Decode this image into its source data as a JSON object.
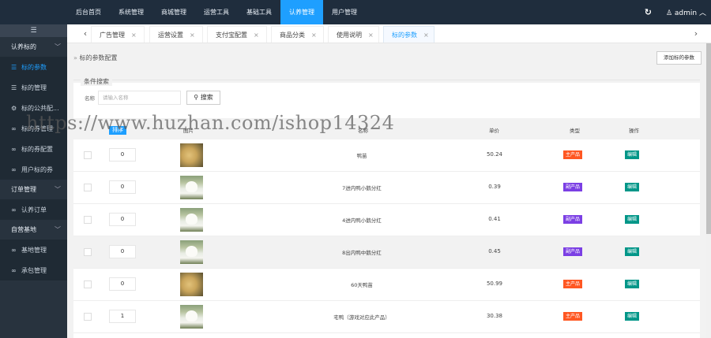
{
  "topnav": {
    "items": [
      "后台首页",
      "系统管理",
      "商城管理",
      "运营工具",
      "基础工具",
      "认养管理",
      "用户管理"
    ],
    "active_index": 5,
    "refresh_icon": "refresh-icon",
    "user_label": "admin",
    "user_icon": "user-icon"
  },
  "sidebar": {
    "toggle_icon": "menu-icon",
    "group1": {
      "label": "认养标的",
      "expanded": true
    },
    "items1": [
      {
        "label": "标的参数",
        "icon": "list-icon",
        "active": true
      },
      {
        "label": "标的管理",
        "icon": "list-icon"
      },
      {
        "label": "标的公共配...",
        "icon": "gear-icon"
      },
      {
        "label": "标的券管理",
        "icon": "link-icon"
      },
      {
        "label": "标的券配置",
        "icon": "link-icon"
      },
      {
        "label": "用户标的券",
        "icon": "link-icon"
      }
    ],
    "group2": {
      "label": "订单管理"
    },
    "items2": [
      {
        "label": "认养订单",
        "icon": "link-icon"
      }
    ],
    "group3": {
      "label": "自营基地"
    },
    "items3": [
      {
        "label": "基地管理",
        "icon": "link-icon"
      },
      {
        "label": "承包管理",
        "icon": "link-icon"
      }
    ]
  },
  "tabs": {
    "items": [
      "广告管理",
      "运营设置",
      "支付宝配置",
      "商品分类",
      "使用说明",
      "标的参数"
    ],
    "active_index": 5,
    "close_glyph": "×",
    "prev_glyph": "‹",
    "next_glyph": "›"
  },
  "page": {
    "breadcrumb_arrow": "»",
    "breadcrumb": "标的参数配置",
    "add_button": "添加标的参数"
  },
  "filter": {
    "title": "条件搜索",
    "label": "名称",
    "placeholder": "请输入名称",
    "search_button": "搜索"
  },
  "table": {
    "headers": {
      "sort": "排序",
      "image": "图片",
      "name": "名称",
      "price": "单价",
      "type": "类型",
      "action": "操作"
    },
    "rows": [
      {
        "sort": "0",
        "image": "chick",
        "name": "鸭苗",
        "price": "50.24",
        "type": "主产品",
        "type_kind": "main",
        "action": "编辑"
      },
      {
        "sort": "0",
        "image": "goose",
        "name": "7进内鸭小鹅分红",
        "price": "0.39",
        "type": "副产品",
        "type_kind": "dividend",
        "action": "编辑"
      },
      {
        "sort": "0",
        "image": "goose",
        "name": "4进内鸭小鹅分红",
        "price": "0.41",
        "type": "副产品",
        "type_kind": "dividend",
        "action": "编辑"
      },
      {
        "sort": "0",
        "image": "goose",
        "name": "8出内鸭中鹅分红",
        "price": "0.45",
        "type": "副产品",
        "type_kind": "dividend",
        "action": "编辑",
        "highlight": true
      },
      {
        "sort": "0",
        "image": "chick",
        "name": "60天鸭苗",
        "price": "50.99",
        "type": "主产品",
        "type_kind": "main",
        "action": "编辑"
      },
      {
        "sort": "1",
        "image": "goose",
        "name": "宅鸭（游戏对应此产品）",
        "price": "30.38",
        "type": "主产品",
        "type_kind": "main",
        "action": "编辑"
      }
    ]
  },
  "watermark": "https://www.huzhan.com/ishop14324",
  "colors": {
    "topbar": "#1f2d3d",
    "active_nav": "#1e9fff",
    "sidebar": "#28333e",
    "badge_main": "#ff5722",
    "badge_dividend": "#7b3fe4",
    "edit": "#009688"
  }
}
